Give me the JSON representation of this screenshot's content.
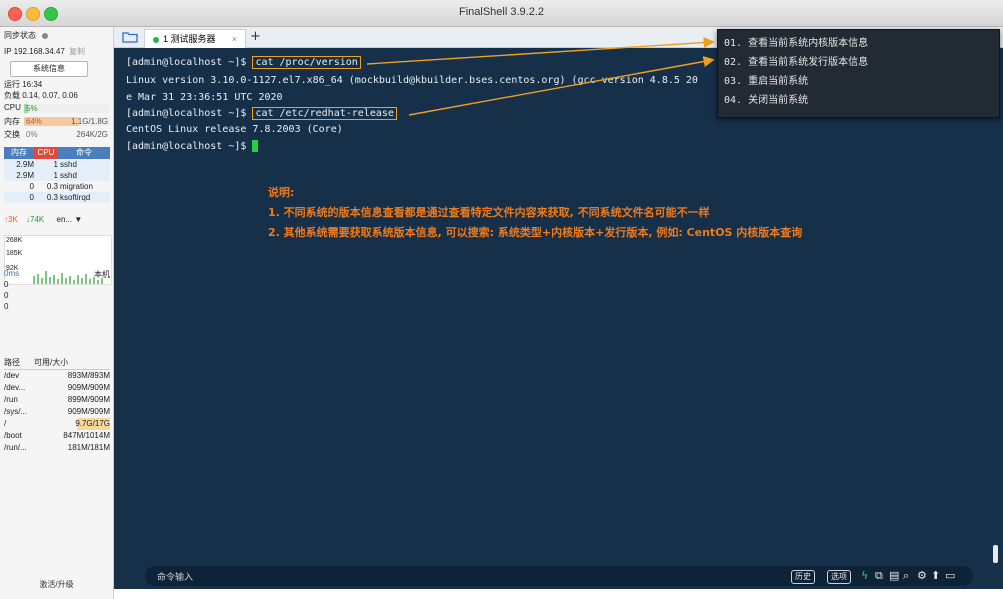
{
  "window": {
    "title": "FinalShell 3.9.2.2"
  },
  "sidebar": {
    "sync_status": "同步状态",
    "ip_label": "IP 192.168.34.47",
    "copy_label": "复制",
    "sysinfo_button": "系统信息",
    "uptime": "运行 16:34",
    "load": "负载 0.14, 0.07, 0.06",
    "cpu_label": "CPU",
    "cpu_value": "5%",
    "cpu_level": 0.05,
    "mem_label": "内存",
    "mem_percent": "64%",
    "mem_value": "1.1G/1.8G",
    "mem_level": 0.64,
    "swap_label": "交换",
    "swap_percent": "0%",
    "swap_value": "264K/2G",
    "proc_headers": [
      "内存",
      "CPU",
      "命令"
    ],
    "processes": [
      {
        "mem": "2.9M",
        "cpu": "1",
        "cmd": "sshd"
      },
      {
        "mem": "2.9M",
        "cpu": "1",
        "cmd": "sshd"
      },
      {
        "mem": "0",
        "cpu": "0.3",
        "cmd": "migration"
      },
      {
        "mem": "0",
        "cpu": "0.3",
        "cmd": "ksoftirqd"
      }
    ],
    "net_up": "↑3K",
    "net_down": "↓74K",
    "net_iface": "en...",
    "net_scale": [
      "268K",
      "185K",
      "92K"
    ],
    "latency_label": "0ms",
    "latency_host": "本机",
    "latency_values": [
      "0",
      "0",
      "0"
    ],
    "disk_headers": [
      "路径",
      "可用/大小"
    ],
    "disks": [
      {
        "path": "/dev",
        "size": "893M/893M"
      },
      {
        "path": "/dev...",
        "size": "909M/909M"
      },
      {
        "path": "/run",
        "size": "899M/909M"
      },
      {
        "path": "/sys/...",
        "size": "909M/909M"
      },
      {
        "path": "/",
        "size": "9.7G/17G"
      },
      {
        "path": "/boot",
        "size": "847M/1014M"
      },
      {
        "path": "/run/...",
        "size": "181M/181M"
      }
    ],
    "activate": "激活/升级"
  },
  "tabs": [
    {
      "label": "1 测试服务器"
    }
  ],
  "terminal": {
    "lines": [
      {
        "prompt": "[admin@localhost ~]$ ",
        "cmd": "cat /proc/version"
      },
      {
        "text": "Linux version 3.10.0-1127.el7.x86_64 (mockbuild@kbuilder.bses.centos.org) (gcc version 4.8.5 20"
      },
      {
        "text": "e Mar 31 23:36:51 UTC 2020"
      },
      {
        "prompt": "[admin@localhost ~]$ ",
        "cmd": "cat /etc/redhat-release"
      },
      {
        "text": "CentOS Linux release 7.8.2003 (Core)"
      },
      {
        "prompt": "[admin@localhost ~]$ "
      }
    ],
    "notes": [
      "说明:",
      "1. 不同系统的版本信息查看都是通过查看特定文件内容来获取, 不同系统文件名可能不一样",
      "2. 其他系统需要获取系统版本信息, 可以搜索: 系统类型+内核版本+发行版本, 例如: CentOS 内核版本查询"
    ]
  },
  "popup": {
    "items": [
      "01. 查看当前系统内核版本信息",
      "02. 查看当前系统发行版本信息",
      "03. 重启当前系统",
      "04. 关闭当前系统"
    ]
  },
  "cmdbar": {
    "label": "命令输入",
    "history": "历史",
    "options": "选项"
  },
  "colors": {
    "terminal_bg": "#17304a",
    "accent_orange": "#f07a1a",
    "cursor_green": "#22d23a"
  }
}
